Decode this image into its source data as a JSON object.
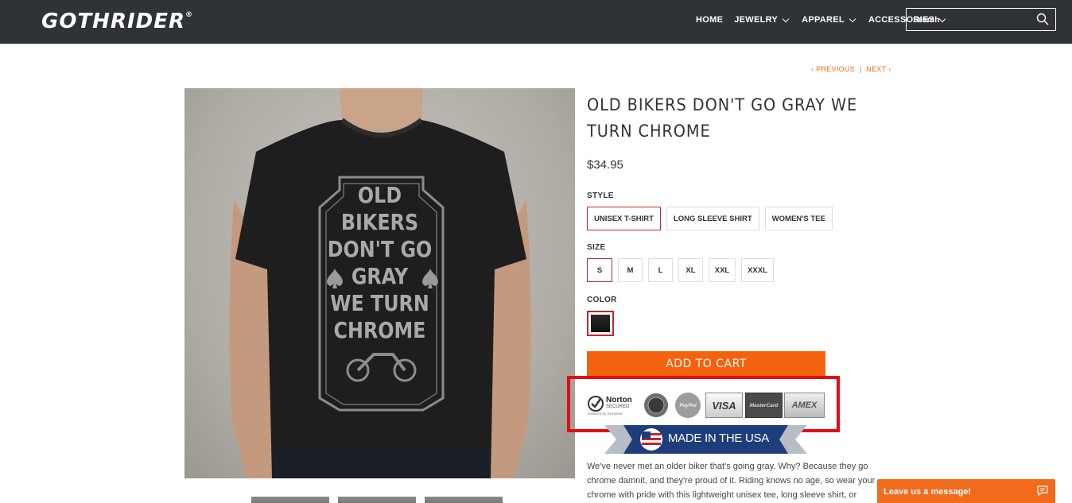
{
  "header": {
    "logo_text": "GOTHRIDER",
    "logo_reg": "®",
    "nav": [
      {
        "label": "HOME",
        "has_dropdown": false
      },
      {
        "label": "JEWELRY",
        "has_dropdown": true
      },
      {
        "label": "APPAREL",
        "has_dropdown": true
      },
      {
        "label": "ACCESSORIES",
        "has_dropdown": true
      }
    ],
    "search_placeholder": "Search"
  },
  "pager": {
    "previous": "PREVIOUS",
    "separator": "|",
    "next": "NEXT"
  },
  "product": {
    "title": "OLD BIKERS DON'T GO GRAY WE TURN CHROME",
    "price": "$34.95",
    "shirt_text": [
      "OLD",
      "BIKERS",
      "DON'T GO",
      "GRAY",
      "WE TURN",
      "CHROME"
    ],
    "style_label": "STYLE",
    "styles": [
      "UNISEX T-SHIRT",
      "LONG SLEEVE SHIRT",
      "WOMEN'S TEE"
    ],
    "style_selected": 0,
    "size_label": "SIZE",
    "sizes": [
      "S",
      "M",
      "L",
      "XL",
      "XXL",
      "XXXL"
    ],
    "size_selected": 0,
    "color_label": "COLOR",
    "add_to_cart": "ADD TO CART",
    "description": "We've never met an older biker that's going gray. Why? Because they go chrome damnit, and they're proud of it. Riding knows no age, so wear your chrome with pride with this lightweight unisex tee, long sleeve shirt, or"
  },
  "trust_badges": {
    "norton": "Norton",
    "norton_sub": "SECURED",
    "norton_powered": "powered by Symantec",
    "paypal": "PayPal",
    "visa": "VISA",
    "mastercard": "MasterCard",
    "amex": "AMEX"
  },
  "made_in": "MADE IN THE USA",
  "chat": {
    "label": "Leave us a message!"
  },
  "colors": {
    "accent": "#f5620f",
    "header_bg": "#2f3236",
    "selected_border": "#c3272b",
    "highlight_box": "#e20c17"
  }
}
